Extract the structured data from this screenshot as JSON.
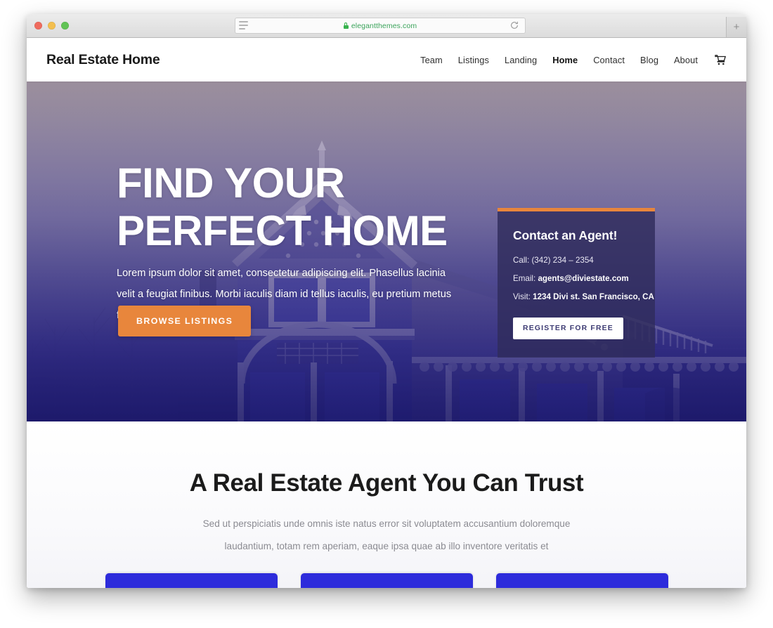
{
  "browser": {
    "url": "elegantthemes.com",
    "secure_icon": "lock-icon",
    "reader_icon": "reader-view-icon",
    "reload_icon": "reload-icon",
    "new_tab_label": "+",
    "traffic_lights": [
      "close",
      "minimize",
      "zoom"
    ]
  },
  "site": {
    "logo": "Real Estate Home",
    "nav": [
      {
        "label": "Team",
        "active": false
      },
      {
        "label": "Listings",
        "active": false
      },
      {
        "label": "Landing",
        "active": false
      },
      {
        "label": "Home",
        "active": true
      },
      {
        "label": "Contact",
        "active": false
      },
      {
        "label": "Blog",
        "active": false
      },
      {
        "label": "About",
        "active": false
      }
    ],
    "cart_icon": "shopping-cart-icon"
  },
  "hero": {
    "title_line1": "FIND YOUR",
    "title_line2": "PERFECT HOME",
    "paragraph": "Lorem ipsum dolor sit amet, consectetur adipiscing elit. Phasellus lacinia velit a feugiat finibus. Morbi iaculis diam id tellus iaculis, eu pretium metus fermentu",
    "cta_label": "BROWSE LISTINGS",
    "cta_color": "#e8863c"
  },
  "agent_card": {
    "title": "Contact an Agent!",
    "call_label": "Call:",
    "call_value": "(342) 234 – 2354",
    "email_label": "Email:",
    "email_value": "agents@diviestate.com",
    "visit_label": "Visit:",
    "visit_value": "1234 Divi st. San Francisco, CA",
    "button_label": "REGISTER FOR FREE",
    "accent_color": "#e8863c"
  },
  "trust": {
    "title": "A Real Estate Agent You Can Trust",
    "paragraph": "Sed ut perspiciatis unde omnis iste natus error sit voluptatem accusantium doloremque laudantium, totam rem aperiam, eaque ipsa quae ab illo inventore veritatis et",
    "cards": [
      {
        "accent": "#2d2bdb"
      },
      {
        "accent": "#2d2bdb"
      },
      {
        "accent": "#2d2bdb"
      }
    ]
  }
}
